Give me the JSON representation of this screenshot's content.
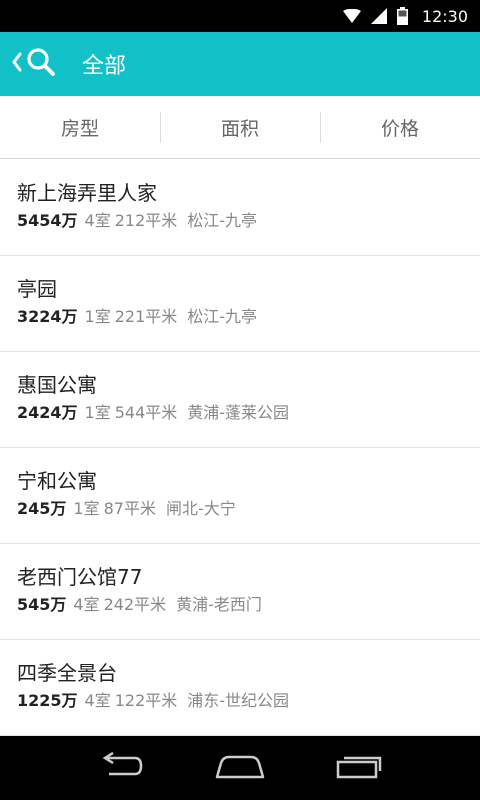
{
  "status_bar": {
    "time": "12:30",
    "icons": [
      "wifi-icon",
      "signal-icon",
      "battery-icon"
    ]
  },
  "app_bar": {
    "title": "全部",
    "back_icon": "chevron-left-icon",
    "search_icon": "search-icon",
    "background": "#12c1c8"
  },
  "filters": [
    {
      "label": "房型"
    },
    {
      "label": "面积"
    },
    {
      "label": "价格"
    }
  ],
  "listings": [
    {
      "name": "新上海弄里人家",
      "price": "5454万",
      "rooms": "4室",
      "area": "212平米",
      "location": "松江-九亭"
    },
    {
      "name": "亭园",
      "price": "3224万",
      "rooms": "1室",
      "area": "221平米",
      "location": "松江-九亭"
    },
    {
      "name": "惠国公寓",
      "price": "2424万",
      "rooms": "1室",
      "area": "544平米",
      "location": "黄浦-蓬莱公园"
    },
    {
      "name": "宁和公寓",
      "price": "245万",
      "rooms": "1室",
      "area": "87平米",
      "location": "闸北-大宁"
    },
    {
      "name": "老西门公馆77",
      "price": "545万",
      "rooms": "4室",
      "area": "242平米",
      "location": "黄浦-老西门"
    },
    {
      "name": "四季全景台",
      "price": "1225万",
      "rooms": "4室",
      "area": "122平米",
      "location": "浦东-世纪公园"
    }
  ],
  "nav_bar": {
    "icons": [
      "back-icon",
      "home-icon",
      "recent-apps-icon"
    ]
  }
}
